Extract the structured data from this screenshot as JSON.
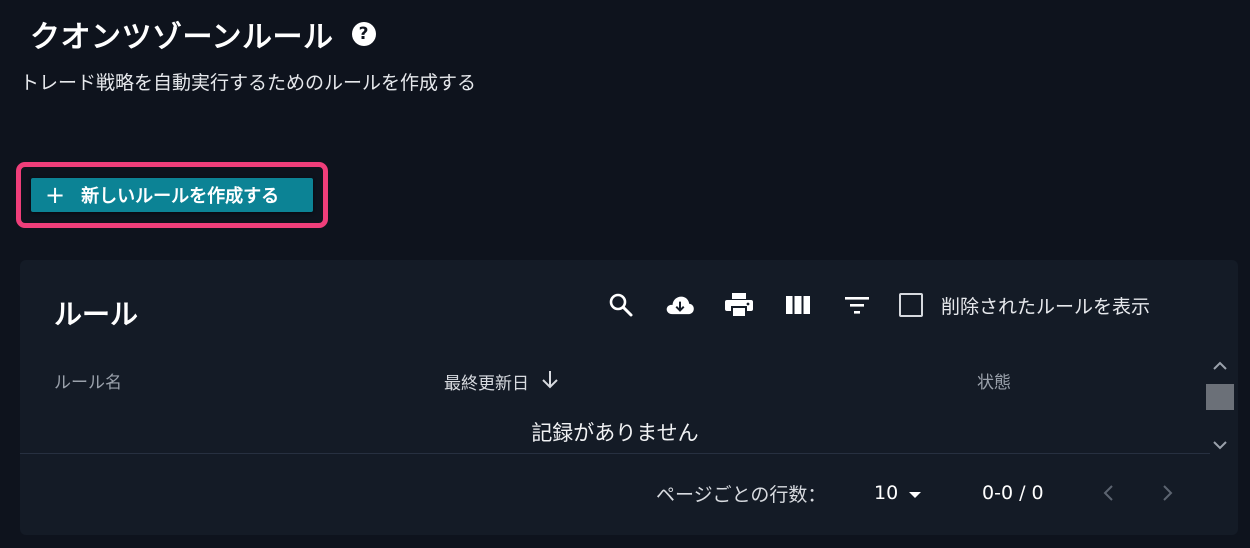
{
  "header": {
    "title": "クオンツゾーンルール",
    "help_icon": "question-circle-icon",
    "subtitle": "トレード戦略を自動実行するためのルールを作成する"
  },
  "create_button": {
    "icon": "plus-icon",
    "label": "新しいルールを作成する",
    "highlight_color": "#ef3e7a",
    "color": "#0c8395"
  },
  "table": {
    "title": "ルール",
    "toolbar": {
      "icons": [
        "search-icon",
        "download-cloud-icon",
        "print-icon",
        "columns-icon",
        "filter-icon"
      ],
      "show_deleted_label": "削除されたルールを表示",
      "show_deleted_checked": false
    },
    "columns": [
      "ルール名",
      "最終更新日",
      "状態"
    ],
    "sort_column": "最終更新日",
    "sort_direction": "descending",
    "empty_message": "記録がありません",
    "pagination": {
      "rows_per_page_label": "ページごとの行数：",
      "rows_per_page": "10",
      "range": "0-0 / 0"
    }
  },
  "colors": {
    "background": "#0e131d",
    "card": "#141b26"
  }
}
